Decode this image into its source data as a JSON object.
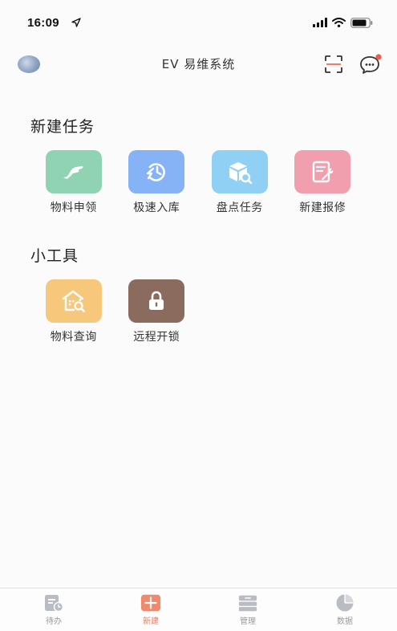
{
  "status_bar": {
    "time": "16:09",
    "icons": [
      "location-arrow-icon",
      "signal-icon",
      "wifi-icon",
      "battery-icon"
    ]
  },
  "header": {
    "title": "EV 易维系统",
    "left_icon": "avatar",
    "right_icons": [
      "scan-icon",
      "message-icon"
    ],
    "notification_dot_color": "#f05a4a"
  },
  "sections": [
    {
      "title": "新建任务",
      "items": [
        {
          "label": "物料申领",
          "icon": "hand-icon",
          "color": "#8fd3b3"
        },
        {
          "label": "极速入库",
          "icon": "speed-clock-icon",
          "color": "#86b2f6"
        },
        {
          "label": "盘点任务",
          "icon": "box-search-icon",
          "color": "#8fd0f4"
        },
        {
          "label": "新建报修",
          "icon": "repair-form-icon",
          "color": "#f19fae"
        }
      ]
    },
    {
      "title": "小工具",
      "items": [
        {
          "label": "物料查询",
          "icon": "warehouse-search-icon",
          "color": "#f7c87c"
        },
        {
          "label": "远程开锁",
          "icon": "lock-icon",
          "color": "#8a6b5e"
        }
      ]
    }
  ],
  "tab_bar": {
    "active": "新建",
    "active_color": "#ee7a5c",
    "tabs": [
      {
        "label": "待办",
        "icon": "todo-icon"
      },
      {
        "label": "新建",
        "icon": "add-icon"
      },
      {
        "label": "管理",
        "icon": "manage-icon"
      },
      {
        "label": "数据",
        "icon": "pie-chart-icon"
      }
    ]
  }
}
